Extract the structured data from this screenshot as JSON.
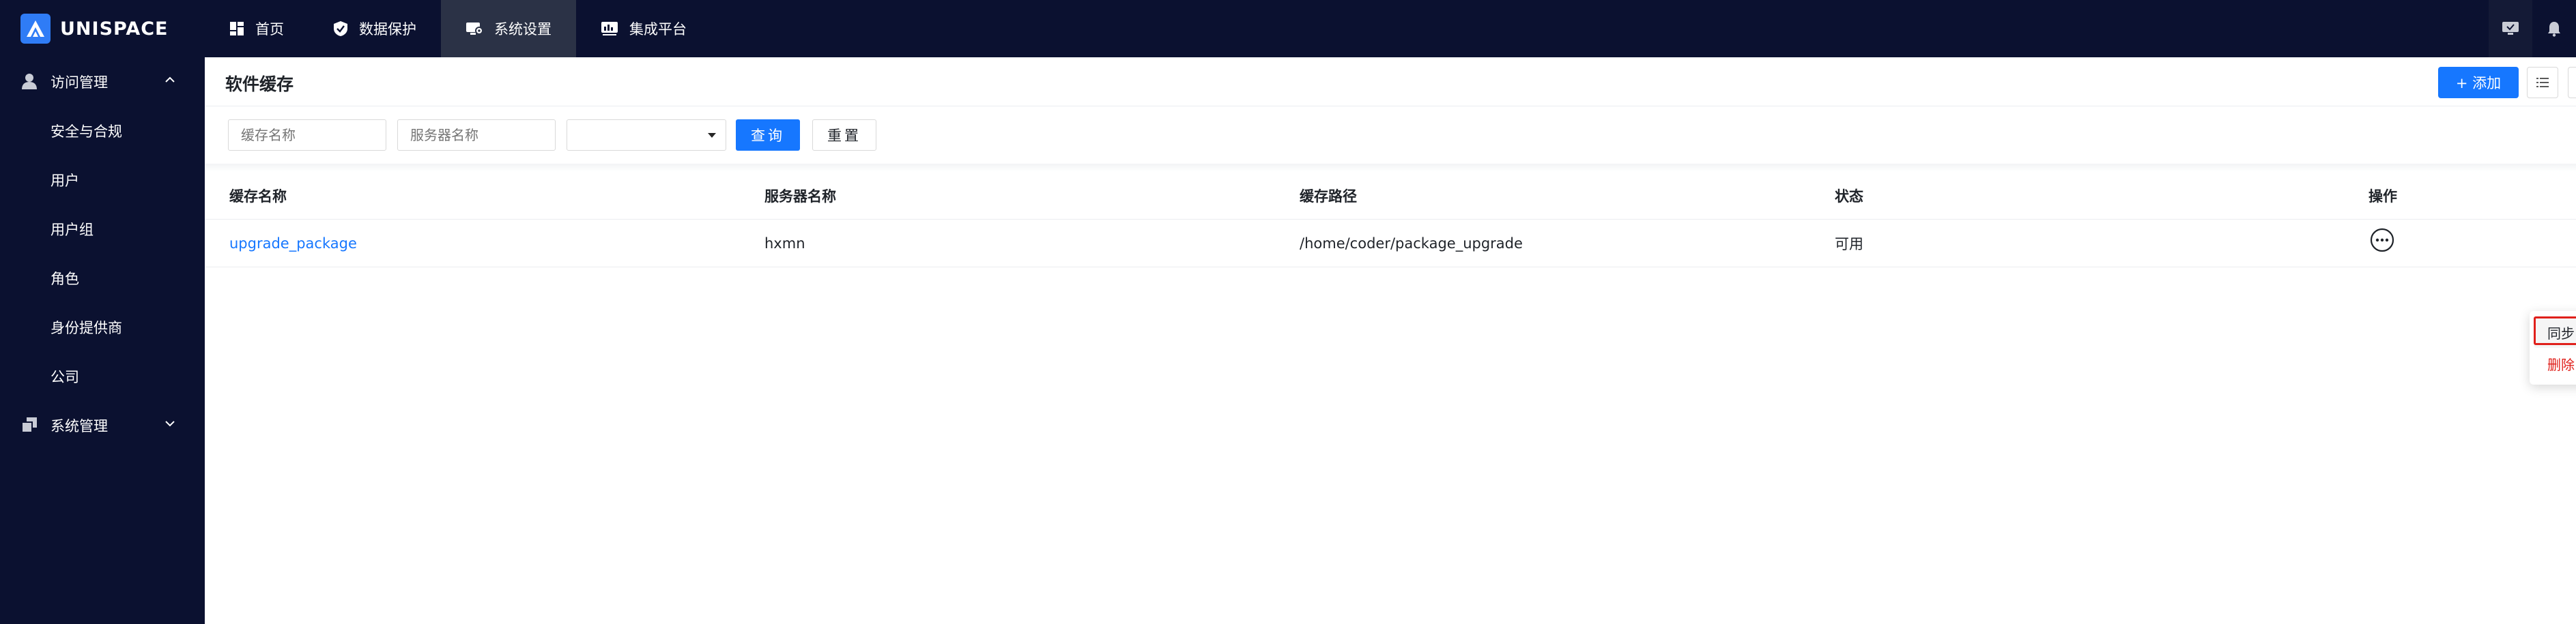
{
  "app": {
    "brand": "UNISPACE"
  },
  "topnav": {
    "items": [
      {
        "label": "首页",
        "icon": "dashboard-icon"
      },
      {
        "label": "数据保护",
        "icon": "shield-icon"
      },
      {
        "label": "系统设置",
        "icon": "settings-monitor-icon",
        "active": true
      },
      {
        "label": "集成平台",
        "icon": "integration-icon"
      }
    ],
    "right_icons": [
      "monitor-chat-icon",
      "bell-icon"
    ]
  },
  "sidebar": {
    "groups": [
      {
        "label": "访问管理",
        "icon": "user-icon",
        "expanded": true,
        "items": [
          "安全与合规",
          "用户",
          "用户组",
          "角色",
          "身份提供商",
          "公司"
        ]
      },
      {
        "label": "系统管理",
        "icon": "stack-icon",
        "expanded": false,
        "items": []
      }
    ]
  },
  "page": {
    "title": "软件缓存",
    "add_button": "+ 添加"
  },
  "filters": {
    "cache_name_placeholder": "缓存名称",
    "server_name_placeholder": "服务器名称",
    "status_select_value": "",
    "query_button": "查询",
    "reset_button": "重置"
  },
  "table": {
    "columns": [
      "缓存名称",
      "服务器名称",
      "缓存路径",
      "状态",
      "操作"
    ],
    "rows": [
      {
        "cache_name": "upgrade_package",
        "server_name": "hxmn",
        "path": "/home/coder/package_upgrade",
        "status": "可用"
      }
    ]
  },
  "row_menu": {
    "sync": "同步",
    "delete": "删除"
  },
  "colors": {
    "topbar_bg": "#0b1130",
    "active_nav_bg": "#2b3246",
    "primary": "#1677ff",
    "danger": "#e0201b"
  }
}
